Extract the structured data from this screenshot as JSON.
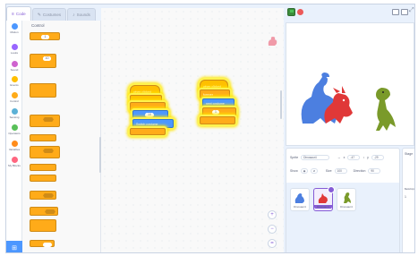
{
  "tabs": [
    {
      "label": "Code",
      "icon": "code-icon"
    },
    {
      "label": "Costumes",
      "icon": "brush-icon"
    },
    {
      "label": "Sounds",
      "icon": "speaker-icon"
    }
  ],
  "categories": [
    {
      "label": "Motion",
      "color": "#4c97ff"
    },
    {
      "label": "Looks",
      "color": "#9966ff"
    },
    {
      "label": "Sound",
      "color": "#cf63cf"
    },
    {
      "label": "Events",
      "color": "#ffbf00"
    },
    {
      "label": "Control",
      "color": "#ffab19"
    },
    {
      "label": "Sensing",
      "color": "#5cb1d6"
    },
    {
      "label": "Operators",
      "color": "#59c059"
    },
    {
      "label": "Variables",
      "color": "#ff8c1a"
    },
    {
      "label": "My Blocks",
      "color": "#ff6680"
    }
  ],
  "palette": {
    "title": "Control",
    "wait_value": "1",
    "repeat_value": "10"
  },
  "scripts": {
    "left": {
      "hat": "when clicked",
      "say_value": "10",
      "switch_label": "Switch costume",
      "costume_value": "Dinosaur"
    },
    "right": {
      "hat": "when clicked",
      "forever_label": "forever",
      "next_label": "next costume",
      "wait_value": "1"
    }
  },
  "sprite_info": {
    "sprite_label": "Sprite",
    "sprite_name": "Dinosaur4",
    "x_label": "x",
    "x_value": "-47",
    "y_label": "y",
    "y_value": "-29",
    "show_label": "Show",
    "size_label": "Size",
    "size_value": "100",
    "direction_label": "Direction",
    "direction_value": "90"
  },
  "sprites": [
    {
      "name": "Dinosaur4",
      "color": "#4c97ff"
    },
    {
      "name": "Dinosaur4",
      "color": "#e63a3a"
    },
    {
      "name": "Dinosaur4",
      "color": "#6aa42a"
    }
  ],
  "stage_panel": {
    "label": "Stage",
    "backdrops_label": "Backdrops",
    "backdrops_count": "1"
  },
  "colors": {
    "accent": "#855cd6",
    "events": "#ffbf00",
    "control": "#ffab19",
    "looks": "#9966ff",
    "motion": "#4c97ff"
  }
}
